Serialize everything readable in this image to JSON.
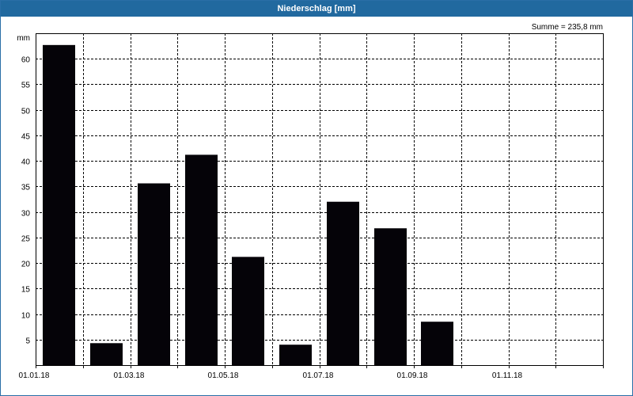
{
  "window": {
    "title": "Niederschlag [mm]"
  },
  "chart_data": {
    "type": "bar",
    "title": "Niederschlag [mm]",
    "ylabel": "mm",
    "annotation": "Summe = 235,8 mm",
    "ylim": [
      0,
      65
    ],
    "yticks": [
      5,
      10,
      15,
      20,
      25,
      30,
      35,
      40,
      45,
      50,
      55,
      60
    ],
    "xticks": [
      "01.01.18",
      "01.03.18",
      "01.05.18",
      "01.07.18",
      "01.09.18",
      "01.11.18"
    ],
    "categories": [
      "Jan 2018",
      "Feb 2018",
      "Mar 2018",
      "Apr 2018",
      "May 2018",
      "Jun 2018",
      "Jul 2018",
      "Aug 2018",
      "Sep 2018",
      "Oct 2018",
      "Nov 2018",
      "Dec 2018"
    ],
    "values": [
      62.7,
      4.3,
      35.6,
      41.2,
      21.2,
      4.0,
      32.0,
      26.8,
      8.5,
      0,
      0,
      0
    ],
    "grid": true,
    "colors": {
      "bar": "#050308",
      "grid": "#000000",
      "titlebar": "#21699f"
    }
  }
}
